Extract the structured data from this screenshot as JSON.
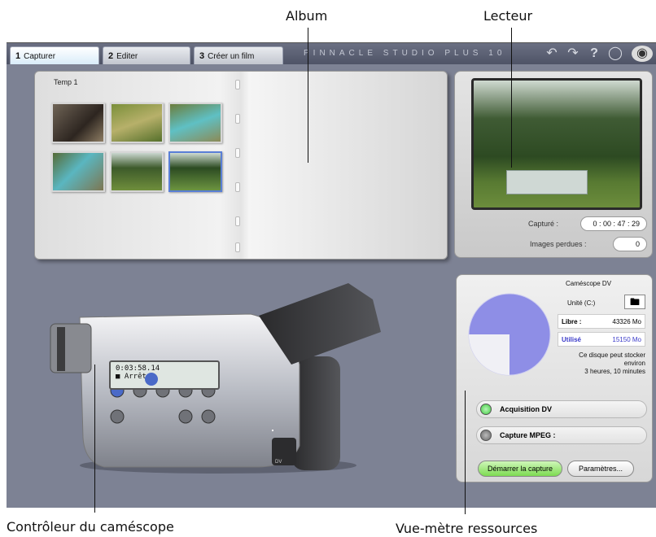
{
  "annotations": {
    "album": "Album",
    "lecteur": "Lecteur",
    "controleur": "Contrôleur du caméscope",
    "vumetre": "Vue-mètre ressources"
  },
  "tabs": [
    {
      "num": "1",
      "label": "Capturer"
    },
    {
      "num": "2",
      "label": "Editer"
    },
    {
      "num": "3",
      "label": "Créer un film"
    }
  ],
  "brand": "PINNACLE STUDIO PLUS 10",
  "toolbar_icons": [
    "undo-icon",
    "redo-icon",
    "help-icon",
    "lightbulb-icon",
    "setup-icon"
  ],
  "album": {
    "page_title": "Temp 1",
    "thumbnails": 6,
    "selected_index": 5
  },
  "player": {
    "captured_label": "Capturé :",
    "captured_value": "0 : 00 : 47 : 29",
    "lost_label": "Images perdues :",
    "lost_value": "0"
  },
  "camcorder": {
    "timecode": "0:03:58.14",
    "status": "Arrêt",
    "badge": "DV"
  },
  "resources": {
    "source": "Caméscope DV",
    "drive": "Unité (C:)",
    "free_label": "Libre :",
    "free_value": "43326 Mo",
    "used_label": "Utilisé",
    "used_value": "15150 Mo",
    "disk_note_1": "Ce disque peut stocker",
    "disk_note_2": "environ",
    "disk_note_3": "3 heures, 10 minutes",
    "used_fraction": 0.26,
    "acquisition_dv": "Acquisition DV",
    "capture_mpeg": "Capture MPEG :",
    "start_button": "Démarrer la capture",
    "settings_button": "Paramètres..."
  },
  "colors": {
    "workspace": "#7d8294",
    "active_led": "#3ecb3e",
    "pie_free": "#8e8ee6",
    "used_text": "#3b3bc9"
  }
}
